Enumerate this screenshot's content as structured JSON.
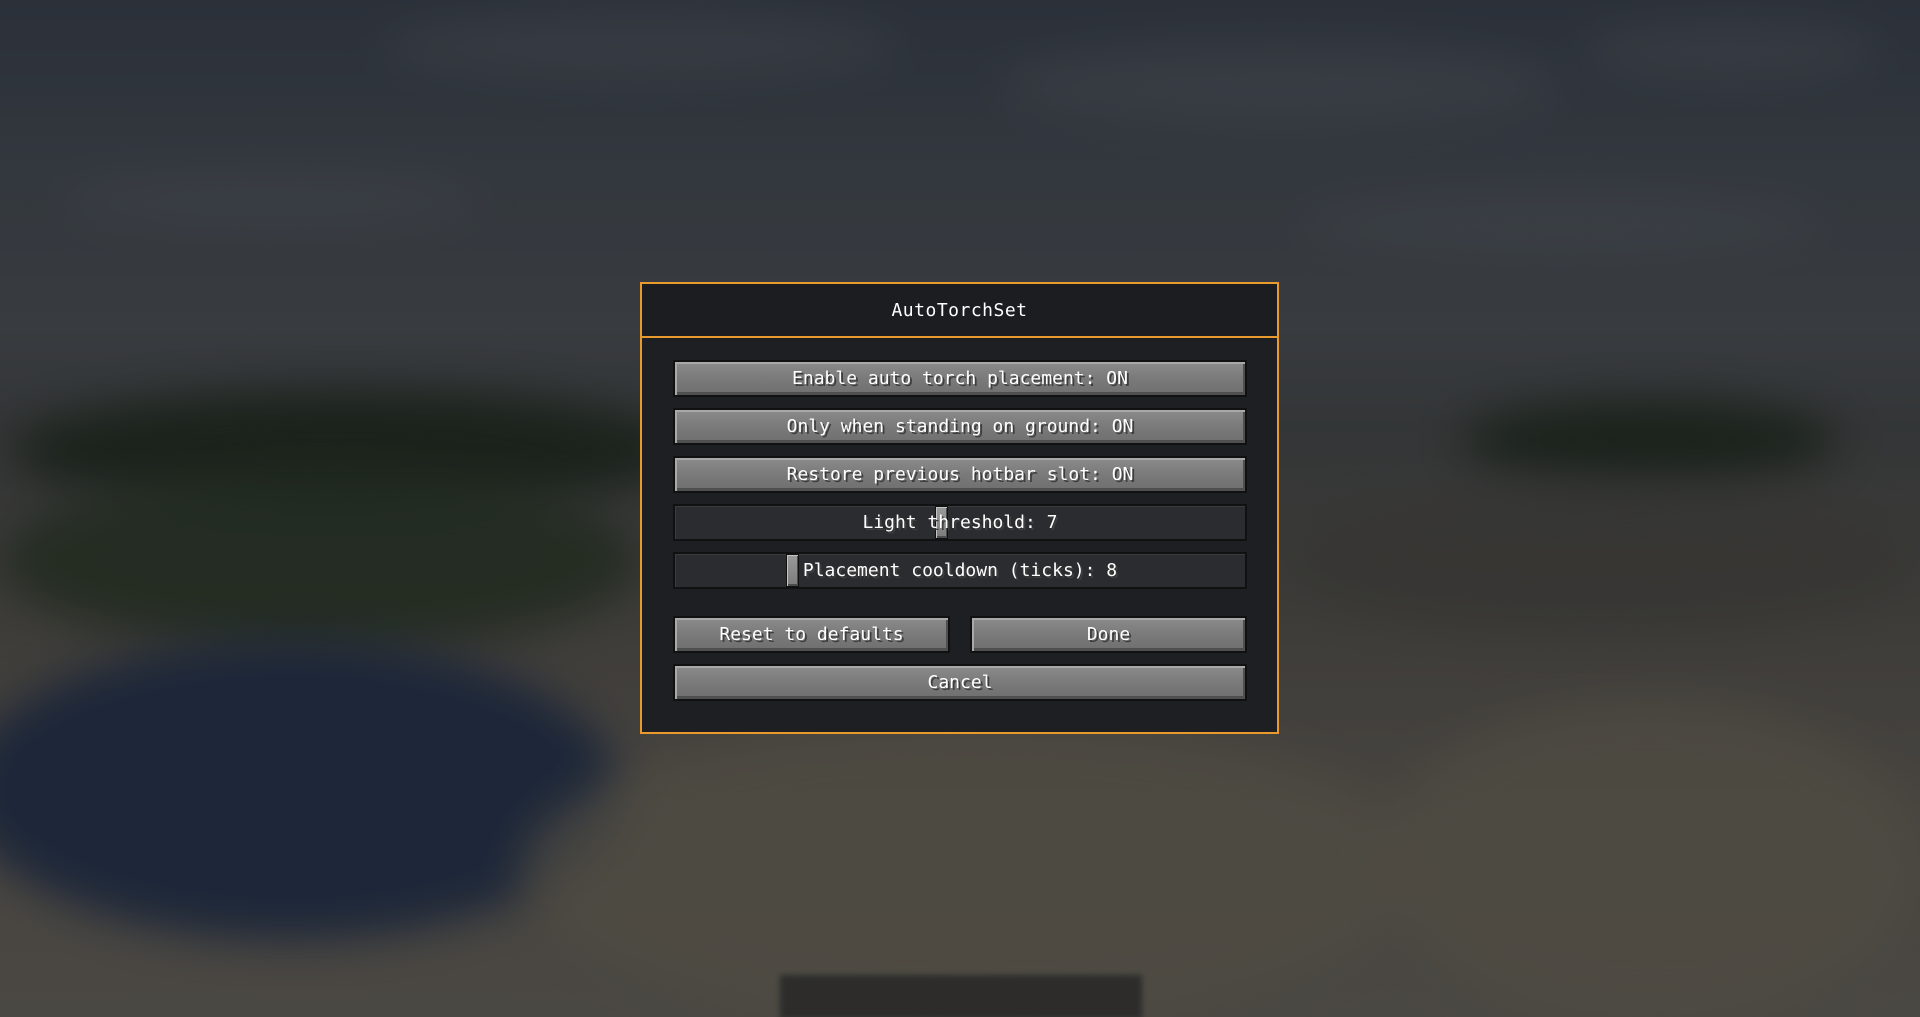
{
  "theme": {
    "accent": "#e89b2c"
  },
  "dialog": {
    "title": "AutoTorchSet"
  },
  "options": {
    "auto_torch_label": "Enable auto torch placement: ON",
    "ground_only_label": "Only when standing on ground: ON",
    "restore_slot_label": "Restore previous hotbar slot: ON"
  },
  "sliders": {
    "light_threshold": {
      "label": "Light threshold: 7",
      "value": 7,
      "min": 0,
      "max": 15
    },
    "placement_cooldown": {
      "label": "Placement cooldown (ticks): 8",
      "value": 8,
      "min": 0,
      "max": 40
    }
  },
  "actions": {
    "reset_label": "Reset to defaults",
    "done_label": "Done",
    "cancel_label": "Cancel"
  }
}
